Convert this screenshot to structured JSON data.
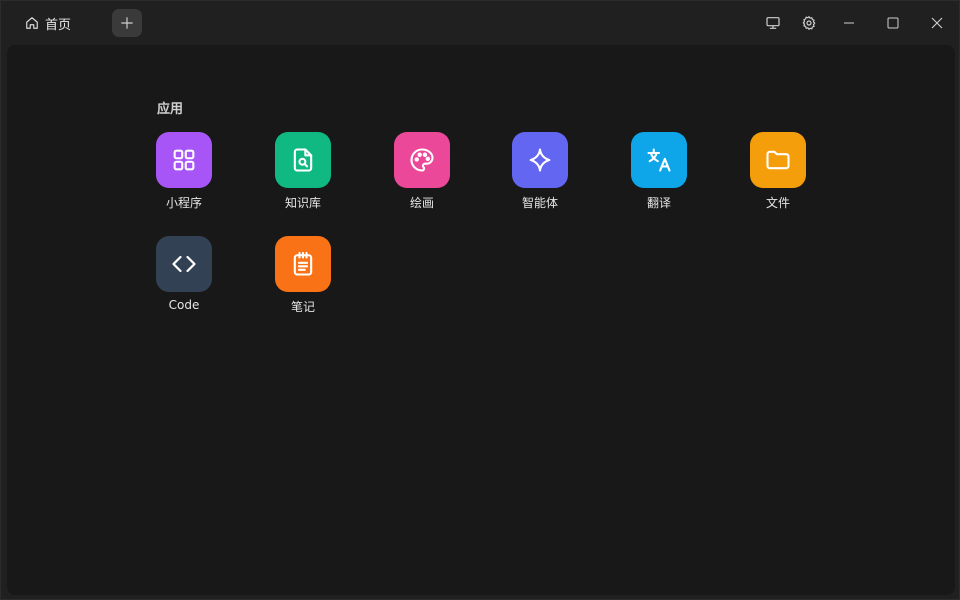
{
  "tab": {
    "label": "首页",
    "icon": "home-icon"
  },
  "section": {
    "title": "应用"
  },
  "apps": [
    {
      "label": "小程序",
      "icon": "grid-icon",
      "color": "#A855F7"
    },
    {
      "label": "知识库",
      "icon": "file-search-icon",
      "color": "#10B981"
    },
    {
      "label": "绘画",
      "icon": "palette-icon",
      "color": "#EC4899"
    },
    {
      "label": "智能体",
      "icon": "sparkle-icon",
      "color": "#6366F1"
    },
    {
      "label": "翻译",
      "icon": "translate-icon",
      "color": "#0EA5E9"
    },
    {
      "label": "文件",
      "icon": "folder-icon",
      "color": "#F59E0B"
    },
    {
      "label": "Code",
      "icon": "code-icon",
      "color": "#334155"
    },
    {
      "label": "笔记",
      "icon": "notepad-icon",
      "color": "#F97316"
    }
  ],
  "colors": {
    "background": "#202020",
    "panel": "#181818"
  }
}
